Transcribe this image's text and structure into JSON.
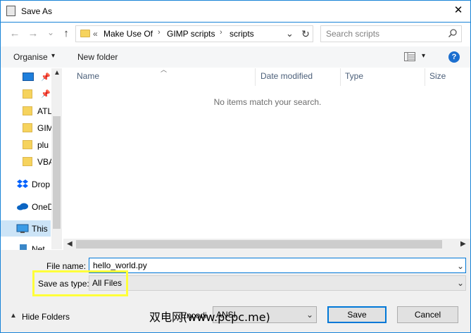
{
  "window": {
    "title": "Save As",
    "close_label": "✕"
  },
  "navigation": {
    "back": "←",
    "forward": "→",
    "recent": "⌄",
    "up": "↑",
    "refresh": "↻",
    "address": {
      "overflow": "«",
      "crumbs": [
        "Make Use Of",
        "GIMP scripts",
        "scripts"
      ],
      "separator": "›",
      "dropdown": "⌄"
    },
    "search": {
      "placeholder": "Search scripts"
    }
  },
  "toolbar": {
    "organise": "Organise",
    "organise_arrow": "▾",
    "new_folder": "New folder",
    "view_arrow": "▾",
    "help": "?"
  },
  "nav_pane": {
    "items": [
      {
        "label": "",
        "icon": "desktop-icon"
      },
      {
        "label": "",
        "icon": "folder-icon"
      },
      {
        "label": "ATL",
        "icon": "folder-icon"
      },
      {
        "label": "GIM",
        "icon": "folder-icon"
      },
      {
        "label": "plu",
        "icon": "folder-icon"
      },
      {
        "label": "VBA",
        "icon": "folder-icon"
      },
      {
        "label": "Drop",
        "icon": "dropbox-icon"
      },
      {
        "label": "OneD",
        "icon": "onedrive-icon"
      },
      {
        "label": "This",
        "icon": "computer-icon"
      },
      {
        "label": "Net",
        "icon": "network-icon"
      }
    ]
  },
  "file_list": {
    "columns": [
      "Name",
      "Date modified",
      "Type",
      "Size"
    ],
    "empty_message": "No items match your search."
  },
  "form": {
    "file_name_label": "File name:",
    "file_name_value": "hello_world.py",
    "save_type_label": "Save as type:",
    "save_type_value": "All Files"
  },
  "footer": {
    "hide_folders": "Hide Folders",
    "encoding_value": "ANSI",
    "encoding_prefix": "Encodi",
    "save": "Save",
    "cancel": "Cancel",
    "watermark": "双电网(www.pcpc.me)"
  },
  "colors": {
    "accent": "#0078d7",
    "highlight": "#ffff3a",
    "folder": "#f6d35d"
  }
}
